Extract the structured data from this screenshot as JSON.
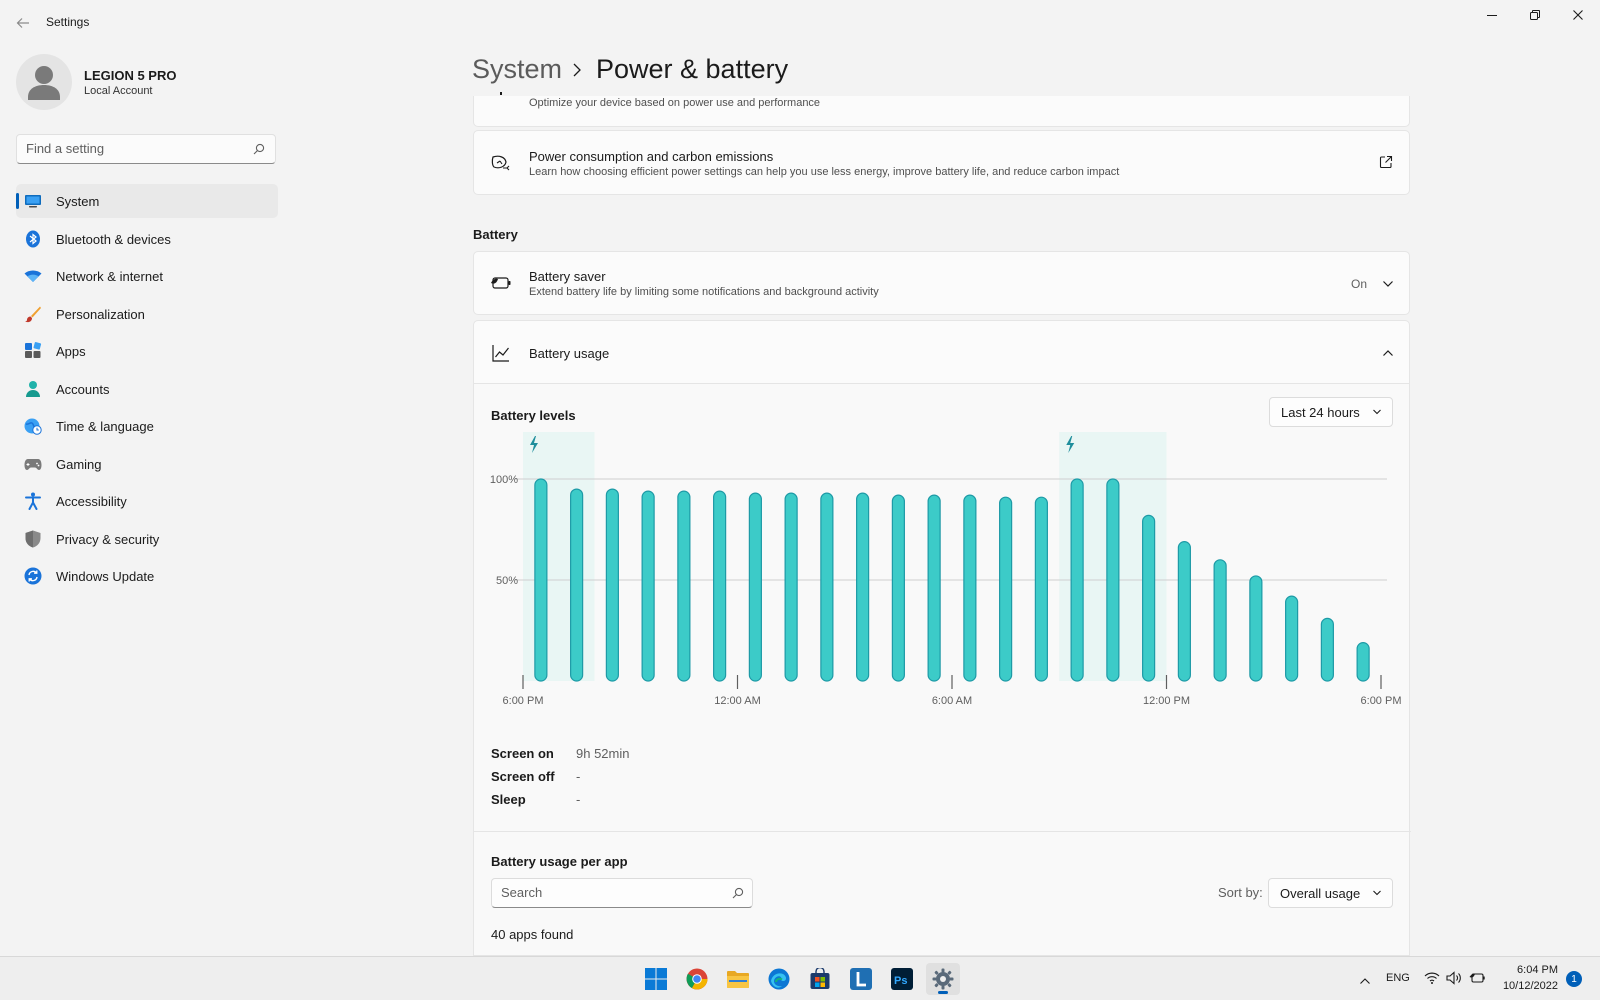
{
  "window": {
    "title": "Settings",
    "controls": [
      "minimize-icon",
      "restore-icon",
      "close-icon"
    ]
  },
  "profile": {
    "name": "LEGION 5 PRO",
    "account": "Local Account"
  },
  "search": {
    "placeholder": "Find a setting"
  },
  "nav": {
    "items": [
      {
        "label": "System",
        "icon": "monitor-icon",
        "active": true
      },
      {
        "label": "Bluetooth & devices",
        "icon": "bluetooth-icon"
      },
      {
        "label": "Network & internet",
        "icon": "wifi-icon"
      },
      {
        "label": "Personalization",
        "icon": "brush-icon"
      },
      {
        "label": "Apps",
        "icon": "apps-icon"
      },
      {
        "label": "Accounts",
        "icon": "person-icon"
      },
      {
        "label": "Time & language",
        "icon": "globe-clock-icon"
      },
      {
        "label": "Gaming",
        "icon": "gamepad-icon"
      },
      {
        "label": "Accessibility",
        "icon": "accessibility-icon"
      },
      {
        "label": "Privacy & security",
        "icon": "shield-icon"
      },
      {
        "label": "Windows Update",
        "icon": "update-icon"
      }
    ]
  },
  "header": {
    "breadcrumb_parent": "System",
    "page_title": "Power & battery"
  },
  "cards": {
    "power_mode_sub": "Optimize your device based on power use and performance",
    "carbon": {
      "title": "Power consumption and carbon emissions",
      "sub": "Learn how choosing efficient power settings can help you use less energy, improve battery life, and reduce carbon impact"
    },
    "battery_section": "Battery",
    "battery_saver": {
      "title": "Battery saver",
      "sub": "Extend battery life by limiting some notifications and background activity",
      "state": "On"
    },
    "battery_usage": {
      "title": "Battery usage"
    }
  },
  "usage": {
    "levels_title": "Battery levels",
    "range_selected": "Last 24 hours",
    "stats": [
      {
        "label": "Screen on",
        "value": "9h 52min"
      },
      {
        "label": "Screen off",
        "value": "-"
      },
      {
        "label": "Sleep",
        "value": "-"
      }
    ],
    "per_app_title": "Battery usage per app",
    "per_app_search_placeholder": "Search",
    "sort_label": "Sort by:",
    "sort_selected": "Overall usage",
    "apps_found": "40 apps found"
  },
  "chart_data": {
    "type": "bar",
    "title": "Battery levels",
    "y_unit": "%",
    "ylim": [
      0,
      100
    ],
    "y_ticks": [
      {
        "value": 100,
        "label": "100%"
      },
      {
        "value": 50,
        "label": "50%"
      }
    ],
    "x_tick_labels": [
      "6:00 PM",
      "12:00 AM",
      "6:00 AM",
      "12:00 PM",
      "6:00 PM"
    ],
    "bar_count": 24,
    "values": [
      100,
      95,
      95,
      94,
      94,
      94,
      93,
      93,
      93,
      93,
      92,
      92,
      92,
      91,
      91,
      100,
      100,
      82,
      69,
      60,
      52,
      42,
      31,
      19
    ],
    "charging_periods": [
      {
        "from_bar": 0,
        "to_bar": 1
      },
      {
        "from_bar": 15,
        "to_bar": 17
      }
    ],
    "grid": true,
    "bar_color": "#3ccbc8",
    "charging_shade_color": "#e9f6f4",
    "charging_icon_color": "#1f8e9c"
  },
  "taskbar": {
    "apps": [
      "windows-start-icon",
      "chrome-icon",
      "file-explorer-icon",
      "edge-icon",
      "store-icon",
      "l-app-icon",
      "photoshop-icon",
      "settings-icon"
    ],
    "language": "ENG",
    "time": "6:04 PM",
    "date": "10/12/2022",
    "notifications": "1"
  },
  "colors": {
    "accent": "#005fb8",
    "background": "#f3f3f3",
    "card": "#fbfbfb"
  }
}
